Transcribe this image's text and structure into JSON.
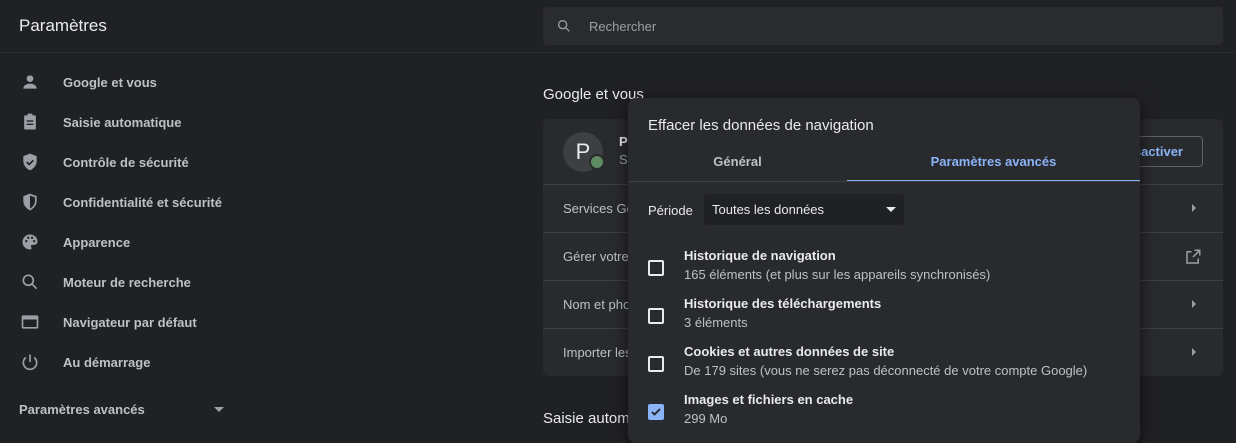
{
  "header": {
    "title": "Paramètres",
    "search_placeholder": "Rechercher"
  },
  "sidebar": {
    "items": [
      {
        "label": "Google et vous",
        "icon": "person-icon"
      },
      {
        "label": "Saisie automatique",
        "icon": "clipboard-icon"
      },
      {
        "label": "Contrôle de sécurité",
        "icon": "shield-check-icon"
      },
      {
        "label": "Confidentialité et sécurité",
        "icon": "shield-icon"
      },
      {
        "label": "Apparence",
        "icon": "palette-icon"
      },
      {
        "label": "Moteur de recherche",
        "icon": "search-icon"
      },
      {
        "label": "Navigateur par défaut",
        "icon": "browser-icon"
      },
      {
        "label": "Au démarrage",
        "icon": "power-icon"
      }
    ],
    "advanced": "Paramètres avancés"
  },
  "main": {
    "section_title": "Google et vous",
    "section2_title": "Saisie autom",
    "profile_initial": "P",
    "profile_name": "P",
    "profile_sub": "S",
    "disable_label": "sactiver",
    "rows": [
      "Services Go",
      "Gérer votre",
      "Nom et pho",
      "Importer les"
    ]
  },
  "dialog": {
    "title": "Effacer les données de navigation",
    "tabs": [
      "Général",
      "Paramètres avancés"
    ],
    "period_label": "Période",
    "period_value": "Toutes les données",
    "options": [
      {
        "title": "Historique de navigation",
        "sub": "165 éléments (et plus sur les appareils synchronisés)",
        "checked": false
      },
      {
        "title": "Historique des téléchargements",
        "sub": "3 éléments",
        "checked": false
      },
      {
        "title": "Cookies et autres données de site",
        "sub": "De 179 sites (vous ne serez pas déconnecté de votre compte Google)",
        "checked": false
      },
      {
        "title": "Images et fichiers en cache",
        "sub": "299 Mo",
        "checked": true
      }
    ]
  },
  "colors": {
    "background": "#202124",
    "surface": "#292a2d",
    "accent": "#8ab4f8",
    "text": "#e8eaed"
  }
}
